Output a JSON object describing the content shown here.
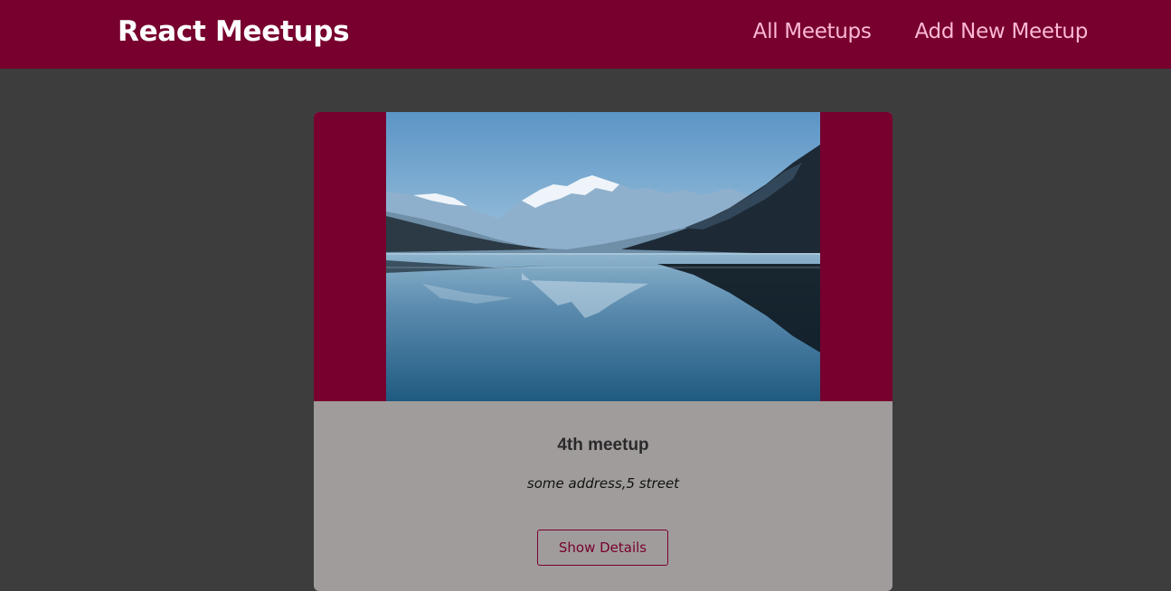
{
  "header": {
    "logo": "React Meetups",
    "nav": [
      {
        "label": "All Meetups"
      },
      {
        "label": "Add New Meetup"
      }
    ]
  },
  "meetup": {
    "title": "4th meetup",
    "address": "some address,5 street",
    "button_label": "Show Details",
    "image": "mountain-lake-photo"
  },
  "colors": {
    "brand": "#77002e",
    "nav_link": "#fcb8d6",
    "page_bg": "#3d3d3d",
    "card_bg": "#a19c9c"
  }
}
